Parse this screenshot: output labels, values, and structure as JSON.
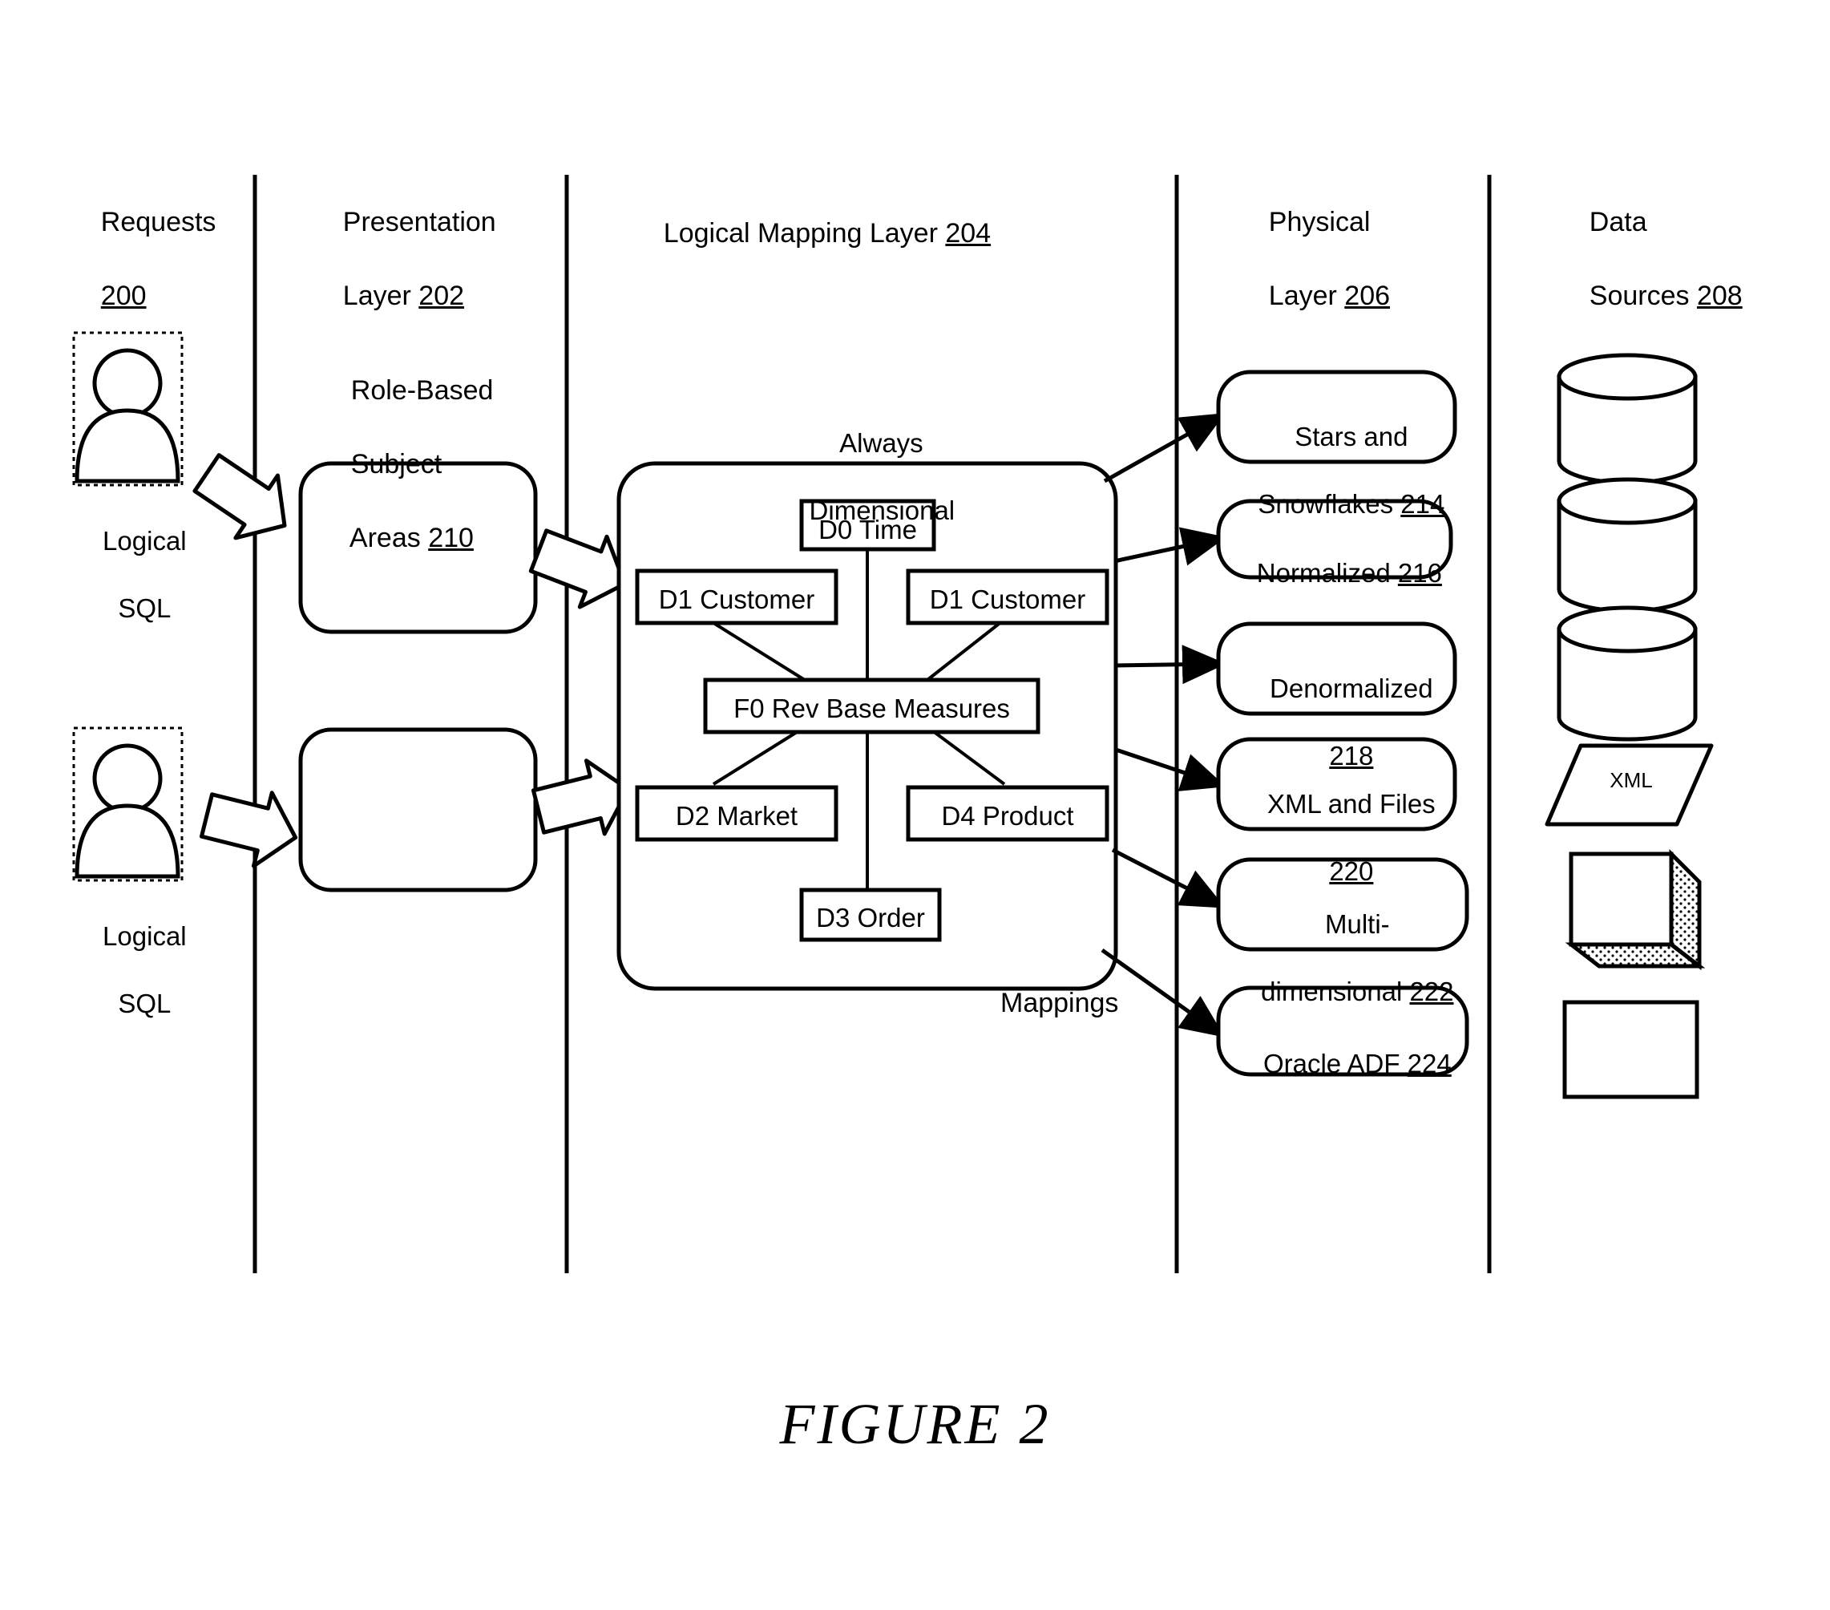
{
  "figure": {
    "caption": "FIGURE 2"
  },
  "columns": [
    {
      "id": "requests",
      "title_line1": "Requests",
      "title_line2": "",
      "ref": "200"
    },
    {
      "id": "presentation",
      "title_line1": "Presentation",
      "title_line2": "Layer ",
      "ref": "202"
    },
    {
      "id": "logical",
      "title_line1": "Logical Mapping Layer ",
      "title_line2": "",
      "ref": "204"
    },
    {
      "id": "physical",
      "title_line1": "Physical",
      "title_line2": "Layer ",
      "ref": "206"
    },
    {
      "id": "sources",
      "title_line1": "Data",
      "title_line2": "Sources ",
      "ref": "208"
    }
  ],
  "requests": {
    "users": [
      {
        "icon": "user-icon",
        "caption_line1": "Logical",
        "caption_line2": "SQL"
      },
      {
        "icon": "user-icon",
        "caption_line1": "Logical",
        "caption_line2": "SQL"
      }
    ]
  },
  "presentation": {
    "group_label_line1": "Role-Based",
    "group_label_line2": "Subject",
    "group_label_line3": "Areas ",
    "group_ref": "210",
    "boxes": [
      {
        "label": ""
      },
      {
        "label": ""
      }
    ]
  },
  "logical": {
    "annotation_line1": "Always",
    "annotation_line2": "Dimensional",
    "mappings_label": "Mappings",
    "nodes": [
      {
        "id": "d0",
        "label": "D0 Time"
      },
      {
        "id": "d1a",
        "label": "D1 Customer"
      },
      {
        "id": "d1b",
        "label": "D1 Customer"
      },
      {
        "id": "f0",
        "label": "F0 Rev Base Measures"
      },
      {
        "id": "d2",
        "label": "D2 Market"
      },
      {
        "id": "d4",
        "label": "D4 Product"
      },
      {
        "id": "d3",
        "label": "D3 Order"
      }
    ]
  },
  "physical": {
    "boxes": [
      {
        "id": "stars",
        "line1": "Stars and",
        "line2": "Snowflakes ",
        "ref": "214"
      },
      {
        "id": "norm",
        "line1": "Normalized ",
        "line2": "",
        "ref": "216"
      },
      {
        "id": "denorm",
        "line1": "Denormalized",
        "line2": "",
        "ref": "218"
      },
      {
        "id": "xmlfiles",
        "line1": "XML and Files",
        "line2": "",
        "ref": "220"
      },
      {
        "id": "multidim",
        "line1": "Multi-",
        "line2": "dimensional ",
        "ref": "222"
      },
      {
        "id": "adf",
        "line1": "Oracle ADF ",
        "line2": "",
        "ref": "224"
      }
    ]
  },
  "sources": {
    "shapes": [
      {
        "id": "db1",
        "kind": "database-cylinder",
        "label": ""
      },
      {
        "id": "db2",
        "kind": "database-cylinder",
        "label": ""
      },
      {
        "id": "db3",
        "kind": "database-cylinder",
        "label": ""
      },
      {
        "id": "xml",
        "kind": "parallelogram",
        "label": "XML"
      },
      {
        "id": "cube",
        "kind": "cube-3d",
        "label": ""
      },
      {
        "id": "rect",
        "kind": "rectangle",
        "label": ""
      }
    ]
  },
  "colors": {
    "stroke": "#000000",
    "fill": "#ffffff",
    "hatch": "#000000"
  }
}
